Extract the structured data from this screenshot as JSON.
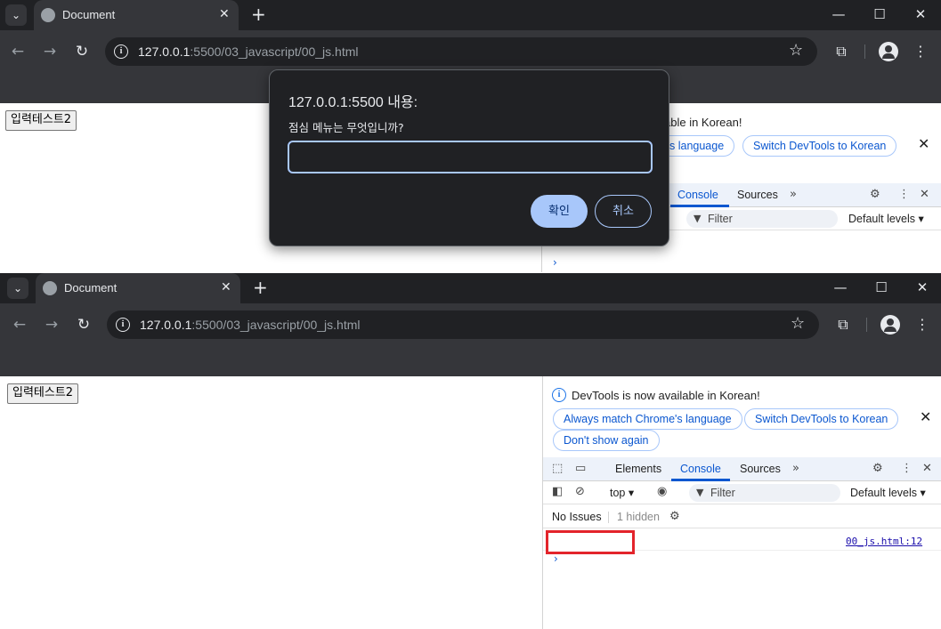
{
  "browser": {
    "tab_title": "Document",
    "url_host": "127.0.0.1",
    "url_rest": ":5500/03_javascript/00_js.html"
  },
  "page": {
    "button_label": "입력테스트2"
  },
  "dialog": {
    "title": "127.0.0.1:5500 내용:",
    "message": "점심 메뉴는 무엇입니까?",
    "input_value": "",
    "ok_label": "확인",
    "cancel_label": "취소"
  },
  "devtools": {
    "banner_text": "DevTools is now available in Korean!",
    "banner_text_partial": "ailable in Korean!",
    "match_language": "Always match Chrome's language",
    "match_language_partial": "s language",
    "switch_korean": "Switch DevTools to Korean",
    "dont_show": "Don't show again",
    "tabs": [
      "Elements",
      "Console",
      "Sources"
    ],
    "active_tab": "Console",
    "context": "top",
    "filter_placeholder": "Filter",
    "levels": "Default levels",
    "issues": "No Issues",
    "hidden": "1 hidden",
    "source_link": "00_js.html:12",
    "console_message": ""
  },
  "colors": {
    "chrome_dark": "#202124",
    "chrome_toolbar": "#35363a",
    "accent_blue": "#0b57d0",
    "dialog_button": "#a8c7fa",
    "highlight_red": "#e3242b"
  }
}
